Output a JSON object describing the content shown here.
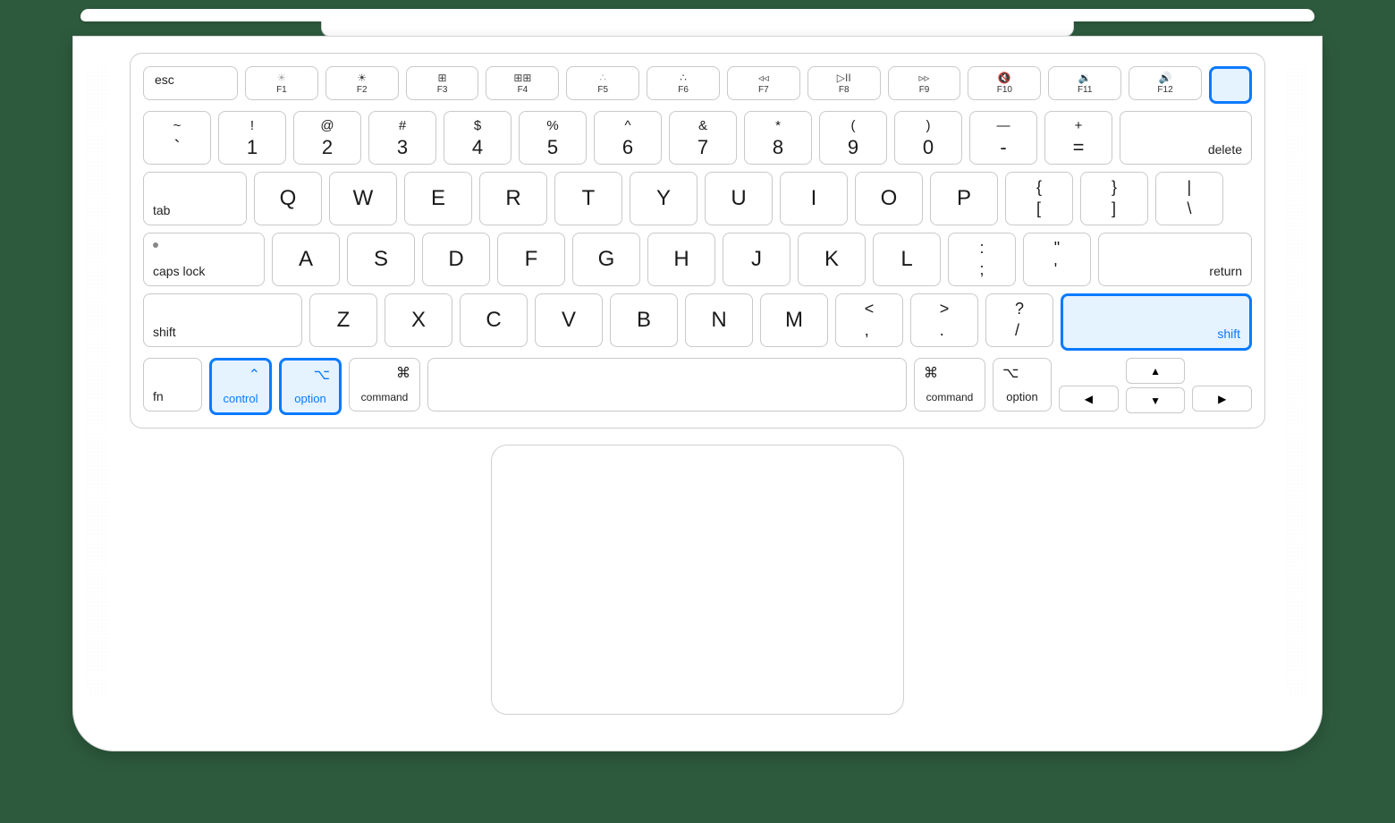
{
  "fnRow": {
    "esc": "esc",
    "keys": [
      {
        "icon": "☀︎",
        "dim": true,
        "label": "F1"
      },
      {
        "icon": "☀︎",
        "dim": false,
        "label": "F2"
      },
      {
        "icon": "⊞",
        "label": "F3"
      },
      {
        "icon": "⊞⊞",
        "label": "F4"
      },
      {
        "icon": "∴",
        "dim": true,
        "label": "F5"
      },
      {
        "icon": "∴",
        "dim": false,
        "label": "F6"
      },
      {
        "icon": "◃◃",
        "label": "F7"
      },
      {
        "icon": "▷II",
        "label": "F8"
      },
      {
        "icon": "▹▹",
        "label": "F9"
      },
      {
        "icon": "🔇",
        "label": "F10"
      },
      {
        "icon": "🔉",
        "label": "F11"
      },
      {
        "icon": "🔊",
        "label": "F12"
      }
    ],
    "touchIdHighlighted": true
  },
  "numberRow": [
    {
      "top": "~",
      "bot": "`"
    },
    {
      "top": "!",
      "bot": "1"
    },
    {
      "top": "@",
      "bot": "2"
    },
    {
      "top": "#",
      "bot": "3"
    },
    {
      "top": "$",
      "bot": "4"
    },
    {
      "top": "%",
      "bot": "5"
    },
    {
      "top": "^",
      "bot": "6"
    },
    {
      "top": "&",
      "bot": "7"
    },
    {
      "top": "*",
      "bot": "8"
    },
    {
      "top": "(",
      "bot": "9"
    },
    {
      "top": ")",
      "bot": "0"
    },
    {
      "top": "—",
      "bot": "-"
    },
    {
      "top": "+",
      "bot": "="
    }
  ],
  "deleteLabel": "delete",
  "tabLabel": "tab",
  "qwerty": [
    "Q",
    "W",
    "E",
    "R",
    "T",
    "Y",
    "U",
    "I",
    "O",
    "P"
  ],
  "bracket1": {
    "top": "{",
    "bot": "["
  },
  "bracket2": {
    "top": "}",
    "bot": "]"
  },
  "backslash": {
    "top": "|",
    "bot": "\\"
  },
  "capsLabel": "caps lock",
  "asdf": [
    "A",
    "S",
    "D",
    "F",
    "G",
    "H",
    "J",
    "K",
    "L"
  ],
  "semicolon": {
    "top": ":",
    "bot": ";"
  },
  "quote": {
    "top": "\"",
    "bot": "'"
  },
  "returnLabel": "return",
  "shiftLabel": "shift",
  "zxcv": [
    "Z",
    "X",
    "C",
    "V",
    "B",
    "N",
    "M"
  ],
  "comma": {
    "top": "<",
    "bot": ","
  },
  "period": {
    "top": ">",
    "bot": "."
  },
  "slash": {
    "top": "?",
    "bot": "/"
  },
  "shiftRightHighlighted": true,
  "bottomRow": {
    "fn": "fn",
    "control": {
      "label": "control",
      "symbol": "⌃",
      "highlighted": true
    },
    "optionL": {
      "label": "option",
      "symbol": "⌥",
      "highlighted": true
    },
    "commandL": {
      "label": "command",
      "symbol": "⌘"
    },
    "commandR": {
      "label": "command",
      "symbol": "⌘"
    },
    "optionR": {
      "label": "option",
      "symbol": "⌥"
    }
  },
  "arrows": {
    "up": "▲",
    "down": "▼",
    "left": "◀",
    "right": "▶"
  }
}
